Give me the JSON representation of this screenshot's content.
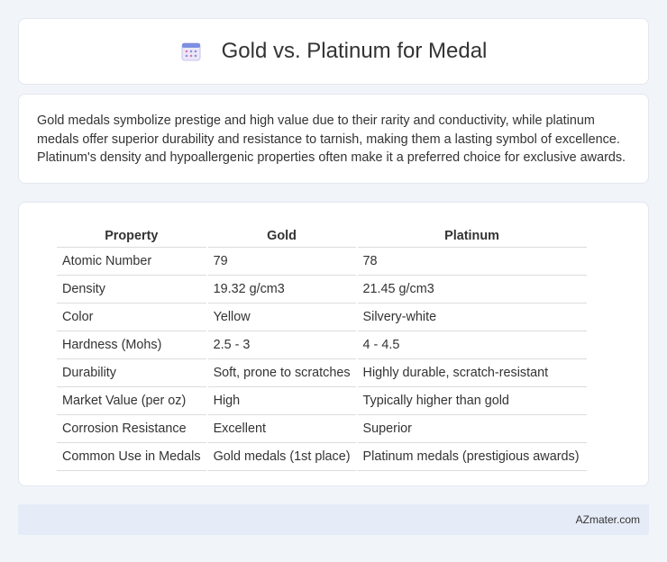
{
  "header": {
    "title": "Gold vs. Platinum for Medal",
    "icon": "calendar-icon"
  },
  "description": "Gold medals symbolize prestige and high value due to their rarity and conductivity, while platinum medals offer superior durability and resistance to tarnish, making them a lasting symbol of excellence. Platinum's density and hypoallergenic properties often make it a preferred choice for exclusive awards.",
  "table": {
    "headers": [
      "Property",
      "Gold",
      "Platinum"
    ],
    "rows": [
      [
        "Atomic Number",
        "79",
        "78"
      ],
      [
        "Density",
        "19.32 g/cm3",
        "21.45 g/cm3"
      ],
      [
        "Color",
        "Yellow",
        "Silvery-white"
      ],
      [
        "Hardness (Mohs)",
        "2.5 - 3",
        "4 - 4.5"
      ],
      [
        "Durability",
        "Soft, prone to scratches",
        "Highly durable, scratch-resistant"
      ],
      [
        "Market Value (per oz)",
        "High",
        "Typically higher than gold"
      ],
      [
        "Corrosion Resistance",
        "Excellent",
        "Superior"
      ],
      [
        "Common Use in Medals",
        "Gold medals (1st place)",
        "Platinum medals (prestigious awards)"
      ]
    ]
  },
  "footer": {
    "text": "AZmater.com"
  },
  "colors": {
    "background": "#f1f4f9",
    "card": "#ffffff",
    "footer": "#e6ecf7",
    "icon_top": "#7b8fe0",
    "icon_body": "#e9e6f7"
  }
}
